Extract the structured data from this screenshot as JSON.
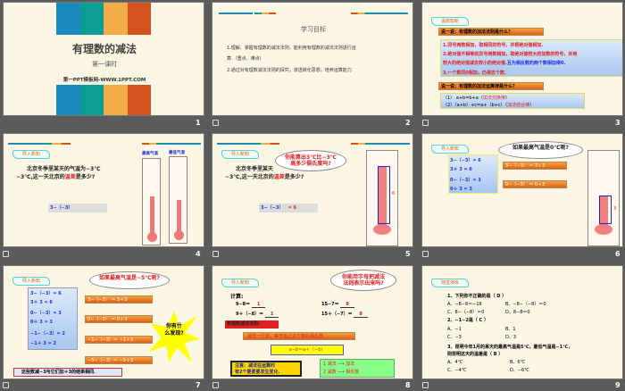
{
  "slides": [
    {
      "number": "1",
      "title": "有理数的减法",
      "subtitle": "第一课时",
      "site": "第一PPT模板网-WWW.1PPT.COM"
    },
    {
      "number": "2",
      "heading": "学习目标",
      "line1": "1.理解、掌握有理数的减法法则，能利用有理数的减法法则进行运",
      "line2": "算.（重点、难点）",
      "line3": "2.通过对有理数减法法则的探究，渗透转化思想，培养运算能力."
    },
    {
      "number": "3",
      "tag": "温故知新",
      "q1": "说一说：有理数的加法法则是什么？",
      "r1": "1.同号两数相加，取相同的符号，并把绝对值相加.",
      "r2a": "2.绝对值不相等的异号两数相加，取绝对值较大的加数的符号，并用",
      "r2b": "较大的绝对值减去较小的绝对值.",
      "r2c": "互为相反数的两个数相加得0.",
      "r3": "3.一个数同0相加，仍得这个数.",
      "q2": "说一说：有理数的加法运算律是什么？",
      "l1a": "（1） a+b=b+a（",
      "l1b": "加法交换律",
      "l1c": "）",
      "l2a": "（2）（a+b）+c=a+（b+c）（",
      "l2b": "加法结合律",
      "l2c": "）"
    },
    {
      "number": "4",
      "tag": "导入新知",
      "p1": "北京冬季里某天的气温为−3℃",
      "p2a": "~3℃,这一天北京的",
      "p2b": "温差",
      "p2c": "是多少?",
      "expr": "3−（−3）",
      "therm1": "最高气温",
      "therm2": "最低气温"
    },
    {
      "number": "5",
      "tag": "导入新知",
      "p1": "北京冬季里某天",
      "p2a": "~3℃,这一天北京的",
      "p2b": "温差",
      "p2c": "是多少?",
      "cloud": "你能算出3℃比−3℃高多少摄氏度吗?",
      "expr": "3−（−3）",
      "res": "= 6",
      "label": "6",
      "ticks": [
        "4",
        "3",
        "2",
        "1",
        "0",
        "-1",
        "-2",
        "-3"
      ]
    },
    {
      "number": "6",
      "tag": "导入新知",
      "cloud": "如果最高气温是0℃呢?",
      "b1": "3−（−3）= 6",
      "b2": "3＋ 3 = 6",
      "b3": "0−（−3）= 3",
      "b4": "0＋ 3 = 3",
      "o1": "3−（−3） ＝ 3＋3",
      "o2": "0−（−3） ＝ 0＋3",
      "label": "3",
      "ticks": [
        "4",
        "3",
        "2",
        "1",
        "0",
        "-1",
        "-2",
        "-3"
      ]
    },
    {
      "number": "7",
      "tag": "导入新知",
      "cloud": "如果最高气温是−5℃呢?",
      "b1": "3−（−3）= 6",
      "b2": "3＋ 3 = 6",
      "b3": "0−（−3）= 3",
      "b4": "0＋ 3 = 3",
      "b5": "−1−（−3）= 2",
      "b6": "−1＋ 3 = 2",
      "o1": "3−（−3） ＝ 3＋3",
      "o2": "0−（−3） ＝ 0＋3",
      "o3": "−1−（−3）＝ −1＋3",
      "o4": "−5−（−3）＝ −5＋3",
      "star": "你有什么发现?",
      "summary": "这些数减−3与它们加＋3的结果相同."
    },
    {
      "number": "8",
      "tag": "导入新知",
      "cloud": "你能用字母把减法法则表示出来吗?",
      "calc": "计算:",
      "e1": "9−8＝",
      "a1": "1",
      "e2": "9＋（−8）＝",
      "a2": "1",
      "e3": "15−7＝",
      "a3": "8",
      "e4": "15＋（−7）＝",
      "a4": "8",
      "rule_title": "有理数减法法则:",
      "rule": "减去一个数，等于加上这个数的相反数.",
      "formula": "a−b＝a＋（−b）",
      "note1": "注意：减法在运算时",
      "note2": "有2个要素要发生变化.",
      "c1a": "1 减法",
      "c1b": "加法",
      "c2a": "2 减数",
      "c2b": "相反数"
    },
    {
      "number": "9",
      "tag": "随堂演练",
      "q1": "1、下列你不正确的是（ D ）",
      "q1a": "A、−8−8＝−16",
      "q1b": "B、−8−（−8）＝0",
      "q1c": "C、8−（−8）＝0",
      "q1d": "D、8−8＝0",
      "q2": "2、−1−2是（ C ）",
      "q2a": "A、−1",
      "q2b": "B、1",
      "q2c": "C、−3",
      "q2d": "D、3",
      "q3a": "3、昆明今年1月的某天的最高气温是5℃，最低气温是−1℃，",
      "q3b": "则昆明这天的温差是（ B ）",
      "q3c": "A、4℃",
      "q3d": "B、6℃",
      "q3e": "C、−4℃",
      "q3f": "D、−6℃"
    }
  ]
}
